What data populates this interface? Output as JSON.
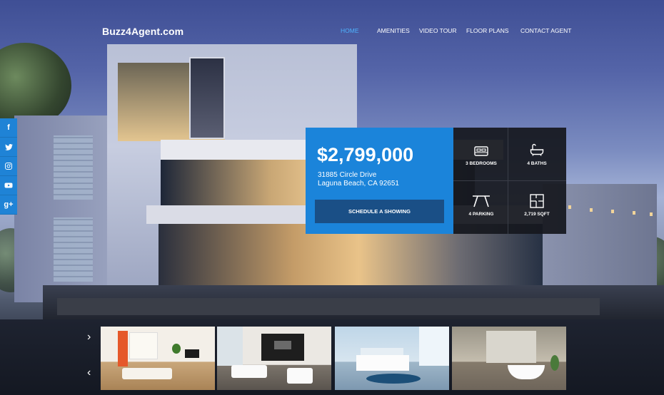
{
  "brand": {
    "logo_text": "Buzz4Agent.com"
  },
  "nav": {
    "items": [
      {
        "label": "HOME",
        "active": true
      },
      {
        "label": "AMENITIES",
        "active": false
      },
      {
        "label": "VIDEO TOUR",
        "active": false
      },
      {
        "label": "FLOOR PLANS",
        "active": false
      },
      {
        "label": "CONTACT AGENT",
        "active": false
      }
    ],
    "active_color": "#4eb3ff"
  },
  "social": {
    "items": [
      {
        "icon": "facebook-icon",
        "glyph": "f"
      },
      {
        "icon": "twitter-icon",
        "glyph": "t"
      },
      {
        "icon": "instagram-icon",
        "glyph": "◙"
      },
      {
        "icon": "youtube-icon",
        "glyph": "▶"
      },
      {
        "icon": "google-plus-icon",
        "glyph": "g+"
      }
    ],
    "color": "#1f83d6"
  },
  "listing": {
    "price": "$2,799,000",
    "address_line1": "31885 Circle Drive",
    "address_line2": "Laguna Beach, CA 92651",
    "cta_label": "SCHEDULE A SHOWING",
    "accent_color": "#1b84da",
    "features": [
      {
        "icon": "bed-icon",
        "label": "3 BEDROOMS"
      },
      {
        "icon": "bathtub-icon",
        "label": "4 BATHS"
      },
      {
        "icon": "parking-icon",
        "label": "4 PARKING"
      },
      {
        "icon": "floorplan-icon",
        "label": "2,719 SQFT"
      }
    ]
  },
  "gallery": {
    "next_icon": "chevron-right-icon",
    "prev_icon": "chevron-left-icon",
    "next_glyph": "›",
    "prev_glyph": "‹",
    "thumbnails": [
      {
        "name": "living-room-photo"
      },
      {
        "name": "lounge-photo"
      },
      {
        "name": "bedroom-photo"
      },
      {
        "name": "bathroom-photo"
      }
    ]
  }
}
